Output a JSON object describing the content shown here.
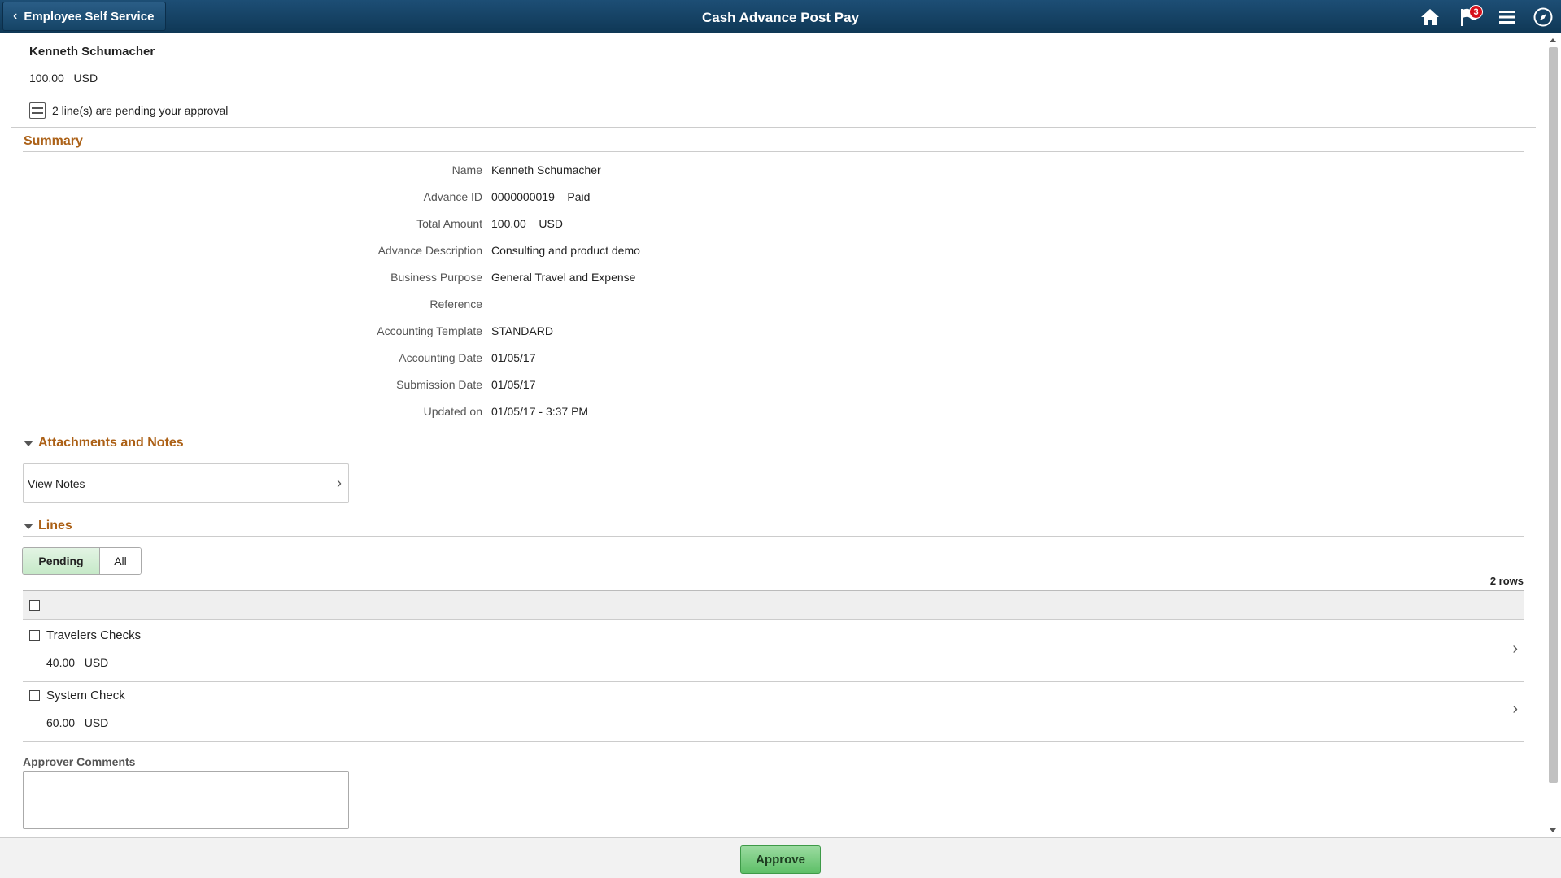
{
  "header": {
    "back_label": "Employee Self Service",
    "title": "Cash Advance Post Pay",
    "notification_count": "3"
  },
  "employee": {
    "name": "Kenneth Schumacher",
    "amount": "100.00",
    "currency": "USD",
    "pending_message": "2 line(s) are pending your approval"
  },
  "summary": {
    "title": "Summary",
    "fields": [
      {
        "label": "Name",
        "value": "Kenneth Schumacher"
      },
      {
        "label": "Advance ID",
        "value": "0000000019    Paid"
      },
      {
        "label": "Total Amount",
        "value": "100.00    USD"
      },
      {
        "label": "Advance Description",
        "value": "Consulting and product demo"
      },
      {
        "label": "Business Purpose",
        "value": "General Travel and Expense"
      },
      {
        "label": "Reference",
        "value": ""
      },
      {
        "label": "Accounting Template",
        "value": "STANDARD"
      },
      {
        "label": "Accounting Date",
        "value": "01/05/17"
      },
      {
        "label": "Submission Date",
        "value": "01/05/17"
      },
      {
        "label": "Updated on",
        "value": "01/05/17 - 3:37 PM"
      }
    ]
  },
  "attachments": {
    "title": "Attachments and Notes",
    "view_notes_label": "View Notes"
  },
  "lines": {
    "title": "Lines",
    "filter_pending": "Pending",
    "filter_all": "All",
    "rows_count": "2 rows",
    "items": [
      {
        "name": "Travelers Checks",
        "amount": "40.00",
        "currency": "USD"
      },
      {
        "name": "System Check",
        "amount": "60.00",
        "currency": "USD"
      }
    ]
  },
  "comments": {
    "label": "Approver Comments",
    "value": ""
  },
  "footer": {
    "approve_label": "Approve"
  },
  "colors": {
    "banner": "#0f3856",
    "section_title": "#ac6117",
    "approve": "#5dbf67",
    "badge": "#d6101a"
  }
}
